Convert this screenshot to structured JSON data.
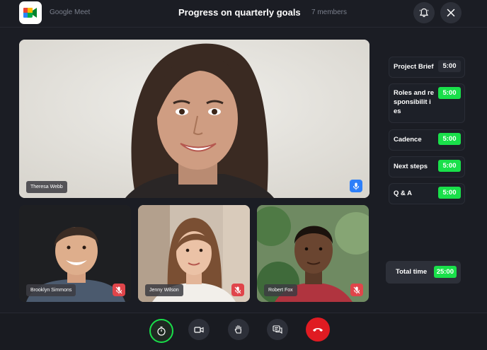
{
  "app": {
    "name": "Google Meet",
    "icon": "google-meet-logo"
  },
  "header": {
    "title": "Progress on quarterly goals",
    "members": "7 members",
    "icons": [
      "bell-icon",
      "close-icon"
    ]
  },
  "participants": [
    {
      "name": "Theresa Webb",
      "mic": "on"
    },
    {
      "name": "Brooklyn Simmons",
      "mic": "muted"
    },
    {
      "name": "Jenny Wilson",
      "mic": "muted"
    },
    {
      "name": "Robert Fox",
      "mic": "muted"
    }
  ],
  "agenda": [
    {
      "label": "Project Brief",
      "time": "5:00",
      "active": false
    },
    {
      "label": "Roles and responsibilit ies",
      "time": "5:00",
      "active": true
    },
    {
      "label": "Cadence",
      "time": "5:00",
      "active": true
    },
    {
      "label": "Next steps",
      "time": "5:00",
      "active": true
    },
    {
      "label": "Q & A",
      "time": "5:00",
      "active": true
    }
  ],
  "total": {
    "label": "Total time",
    "value": "25:00"
  },
  "controls": [
    "timer-icon",
    "camera-icon",
    "raise-hand-icon",
    "chat-icon",
    "end-call-icon"
  ],
  "colors": {
    "accent_green": "#19e04a",
    "end_call_red": "#e01b22",
    "mic_on_blue": "#2d7ff9",
    "mic_muted_red": "#e0454a",
    "background": "#1b1d24"
  }
}
